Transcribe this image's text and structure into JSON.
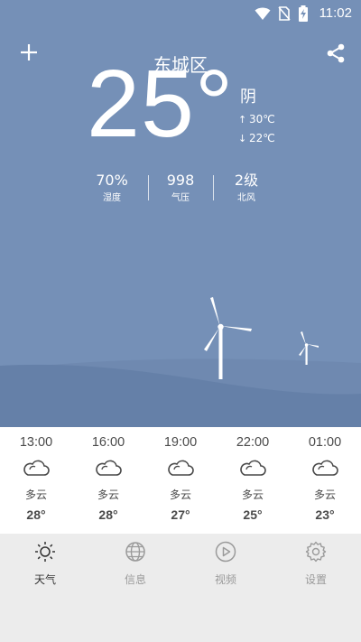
{
  "status_bar": {
    "time": "11:02",
    "icons": [
      "wifi-icon",
      "no-sim-icon",
      "battery-charging-icon"
    ]
  },
  "header": {
    "city": "东城区",
    "add_icon": "plus-icon",
    "share_icon": "share-icon"
  },
  "current": {
    "temperature": "25°",
    "condition": "阴",
    "high": "30℃",
    "low": "22℃"
  },
  "stats": [
    {
      "value": "70%",
      "label": "湿度"
    },
    {
      "value": "998",
      "label": "气压"
    },
    {
      "value": "2级",
      "label": "北风"
    }
  ],
  "hourly": [
    {
      "time": "13:00",
      "condition": "多云",
      "temp": "28°",
      "icon": "cloud-icon"
    },
    {
      "time": "16:00",
      "condition": "多云",
      "temp": "28°",
      "icon": "cloud-icon"
    },
    {
      "time": "19:00",
      "condition": "多云",
      "temp": "27°",
      "icon": "cloud-icon"
    },
    {
      "time": "22:00",
      "condition": "多云",
      "temp": "25°",
      "icon": "cloud-icon"
    },
    {
      "time": "01:00",
      "condition": "多云",
      "temp": "23°",
      "icon": "cloud-icon"
    }
  ],
  "tabs": [
    {
      "label": "天气",
      "icon": "sun-icon",
      "active": true
    },
    {
      "label": "信息",
      "icon": "globe-icon",
      "active": false
    },
    {
      "label": "视频",
      "icon": "play-icon",
      "active": false
    },
    {
      "label": "设置",
      "icon": "gear-icon",
      "active": false
    }
  ],
  "colors": {
    "sky": "#7590b7",
    "hill": "#6a84ab",
    "accent_text": "#ffffff",
    "tab_bar": "#ececec"
  }
}
